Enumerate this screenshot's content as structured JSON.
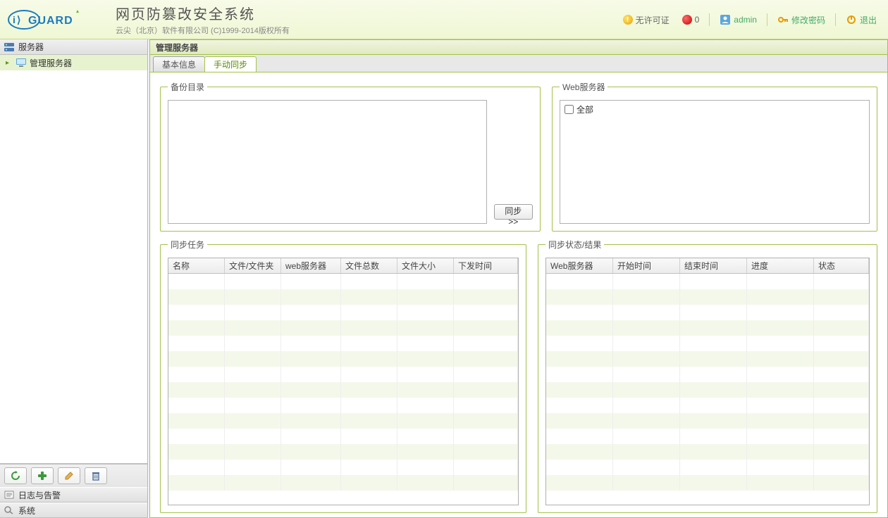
{
  "header": {
    "logo_text": "iGUARD",
    "title": "网页防篡改安全系统",
    "subtitle": "云尖（北京）软件有限公司 (C)1999-2014版权所有",
    "license_label": "无许可证",
    "count": "0",
    "username": "admin",
    "change_pwd": "修改密码",
    "logout": "退出"
  },
  "sidebar": {
    "sections": {
      "servers": "服务器",
      "logs": "日志与告警",
      "system": "系统"
    },
    "tree_item": "管理服务器",
    "toolbar": {
      "refresh": "刷新",
      "add": "新增",
      "edit": "编辑",
      "delete": "删除"
    }
  },
  "content": {
    "panel_title": "管理服务器",
    "tabs": {
      "basic": "基本信息",
      "manual_sync": "手动同步"
    },
    "backup_legend": "备份目录",
    "web_legend": "Web服务器",
    "sync_button": "同步>>",
    "all_checkbox": "全部",
    "tasks_legend": "同步任务",
    "status_legend": "同步状态/结果",
    "tasks_columns": [
      "名称",
      "文件/文件夹",
      "web服务器",
      "文件总数",
      "文件大小",
      "下发时间"
    ],
    "status_columns": [
      "Web服务器",
      "开始时间",
      "结束时间",
      "进度",
      "状态"
    ]
  }
}
